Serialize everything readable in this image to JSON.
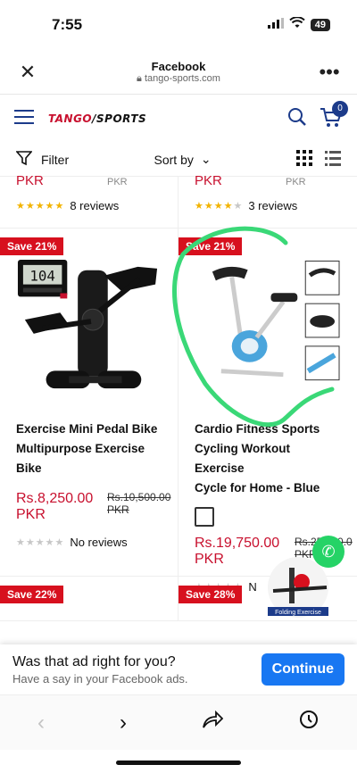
{
  "status": {
    "time": "7:55",
    "battery": "49"
  },
  "browser": {
    "title": "Facebook",
    "url": "tango-sports.com"
  },
  "site": {
    "logo_a": "TANGO",
    "logo_b": "/SPORTS",
    "cart_count": "0"
  },
  "toolbar": {
    "filter_label": "Filter",
    "sort_label": "Sort by"
  },
  "top_row": [
    {
      "price": "PKR",
      "old_price": "PKR",
      "reviews": "8 reviews",
      "rating": 5
    },
    {
      "price": "PKR",
      "old_price": "PKR",
      "reviews": "3 reviews",
      "rating": 4.5
    }
  ],
  "products": [
    {
      "badge": "Save 21%",
      "title_lines": [
        "Exercise Mini Pedal Bike",
        "Multipurpose Exercise",
        "Bike"
      ],
      "price": "Rs.8,250.00",
      "price_unit": "PKR",
      "old_price": "Rs.10,500.00",
      "old_unit": "PKR",
      "reviews": "No reviews",
      "display_reading": "104"
    },
    {
      "badge": "Save 21%",
      "title_lines": [
        "Cardio Fitness Sports",
        "Cycling Workout Exercise",
        "Cycle for Home - Blue"
      ],
      "price": "Rs.19,750.00",
      "price_unit": "PKR",
      "old_price": "Rs.25,000.0",
      "old_unit": "PKR",
      "reviews": "N"
    }
  ],
  "bottom_row": [
    {
      "badge": "Save 22%"
    },
    {
      "badge": "Save 28%",
      "promo_text": "Folding Exercise"
    }
  ],
  "ad_prompt": {
    "question": "Was that ad right for you?",
    "subtext": "Have a say in your Facebook ads.",
    "button": "Continue"
  },
  "colors": {
    "brand_red": "#c8102e",
    "navy": "#1c3b8a",
    "fb_blue": "#1877f2",
    "scribble": "#3ad877"
  }
}
